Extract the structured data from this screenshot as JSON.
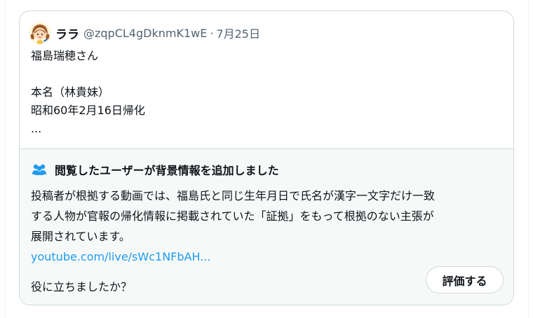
{
  "tweet": {
    "display_name": "ララ",
    "handle": "@zqpCL4gDknmK1wE",
    "separator": "·",
    "date": "7月25日",
    "avatar_icon": "avatar-girl-icon",
    "lines": [
      "福島瑞穂さん",
      "",
      "本名（林貴妹）",
      "昭和60年2月16日帰化",
      "..."
    ]
  },
  "community_note": {
    "icon": "people-icon",
    "title": "閲覧したユーザーが背景情報を追加しました",
    "body_lines": [
      "投稿者が根拠する動画では、福島氏と同じ生年月日で氏名が漢字一文字だけ一致",
      "する人物が官報の帰化情報に掲載されていた「証拠」をもって根拠のない主張が",
      "展開されています。"
    ],
    "link_text": "youtube.com/live/sWc1NFbAH...",
    "helpful_question": "役に立ちましたか？",
    "rate_button_label": "評価する"
  },
  "colors": {
    "text": "#0f1419",
    "secondary_text": "#536471",
    "link": "#1d9bf0",
    "border": "#cfd9de",
    "note_background": "#f7f9f9",
    "note_icon": "#1d9bf0"
  }
}
